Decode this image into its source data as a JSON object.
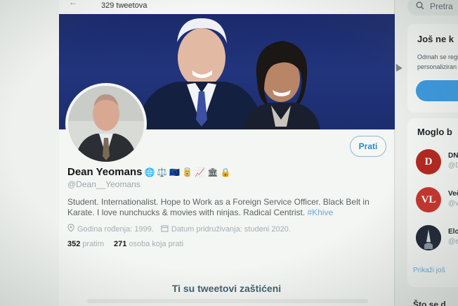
{
  "header": {
    "tweet_count": "329 tweetova"
  },
  "profile": {
    "display_name": "Dean Yeomans",
    "handle": "@Dean__Yeomans",
    "follow_label": "Prati",
    "bio_text": "Student. Internationalist. Hope to Work as a Foreign Service Officer. Black Belt in Karate. I love nunchucks & movies with ninjas. Radical Centrist.",
    "bio_hashtag": "#Khive",
    "name_emojis": [
      "🌐",
      "⚖️",
      "🇪🇺",
      "🥫",
      "📈",
      "🏛",
      "🔒"
    ],
    "birth": "Godina rođenja: 1999.",
    "joined": "Datum pridruživanja: studeni 2020.",
    "following_count": "352",
    "following_label": "pratim",
    "followers_count": "271",
    "followers_label": "osoba koja prati",
    "protected_title": "Ti su tweetovi zaštićeni"
  },
  "sidebar": {
    "search_placeholder": "Pretra",
    "card1_title": "Još ne k",
    "card1_line1": "Odmah se regi",
    "card1_line2": "personaliziran",
    "card2_title": "Moglo b",
    "suggestions": [
      {
        "initials": "D",
        "name": "DN",
        "handle": "@D",
        "color": "#b3261e"
      },
      {
        "initials": "VL",
        "name": "Več",
        "handle": "@v",
        "color": "#c6332b"
      },
      {
        "initials": "",
        "name": "Elo",
        "handle": "@el",
        "color": "#1c2333"
      }
    ],
    "show_more": "Prikaži još",
    "what_title": "Što se d"
  },
  "colors": {
    "accent": "#2a89c9",
    "banner": "#1f3176"
  }
}
